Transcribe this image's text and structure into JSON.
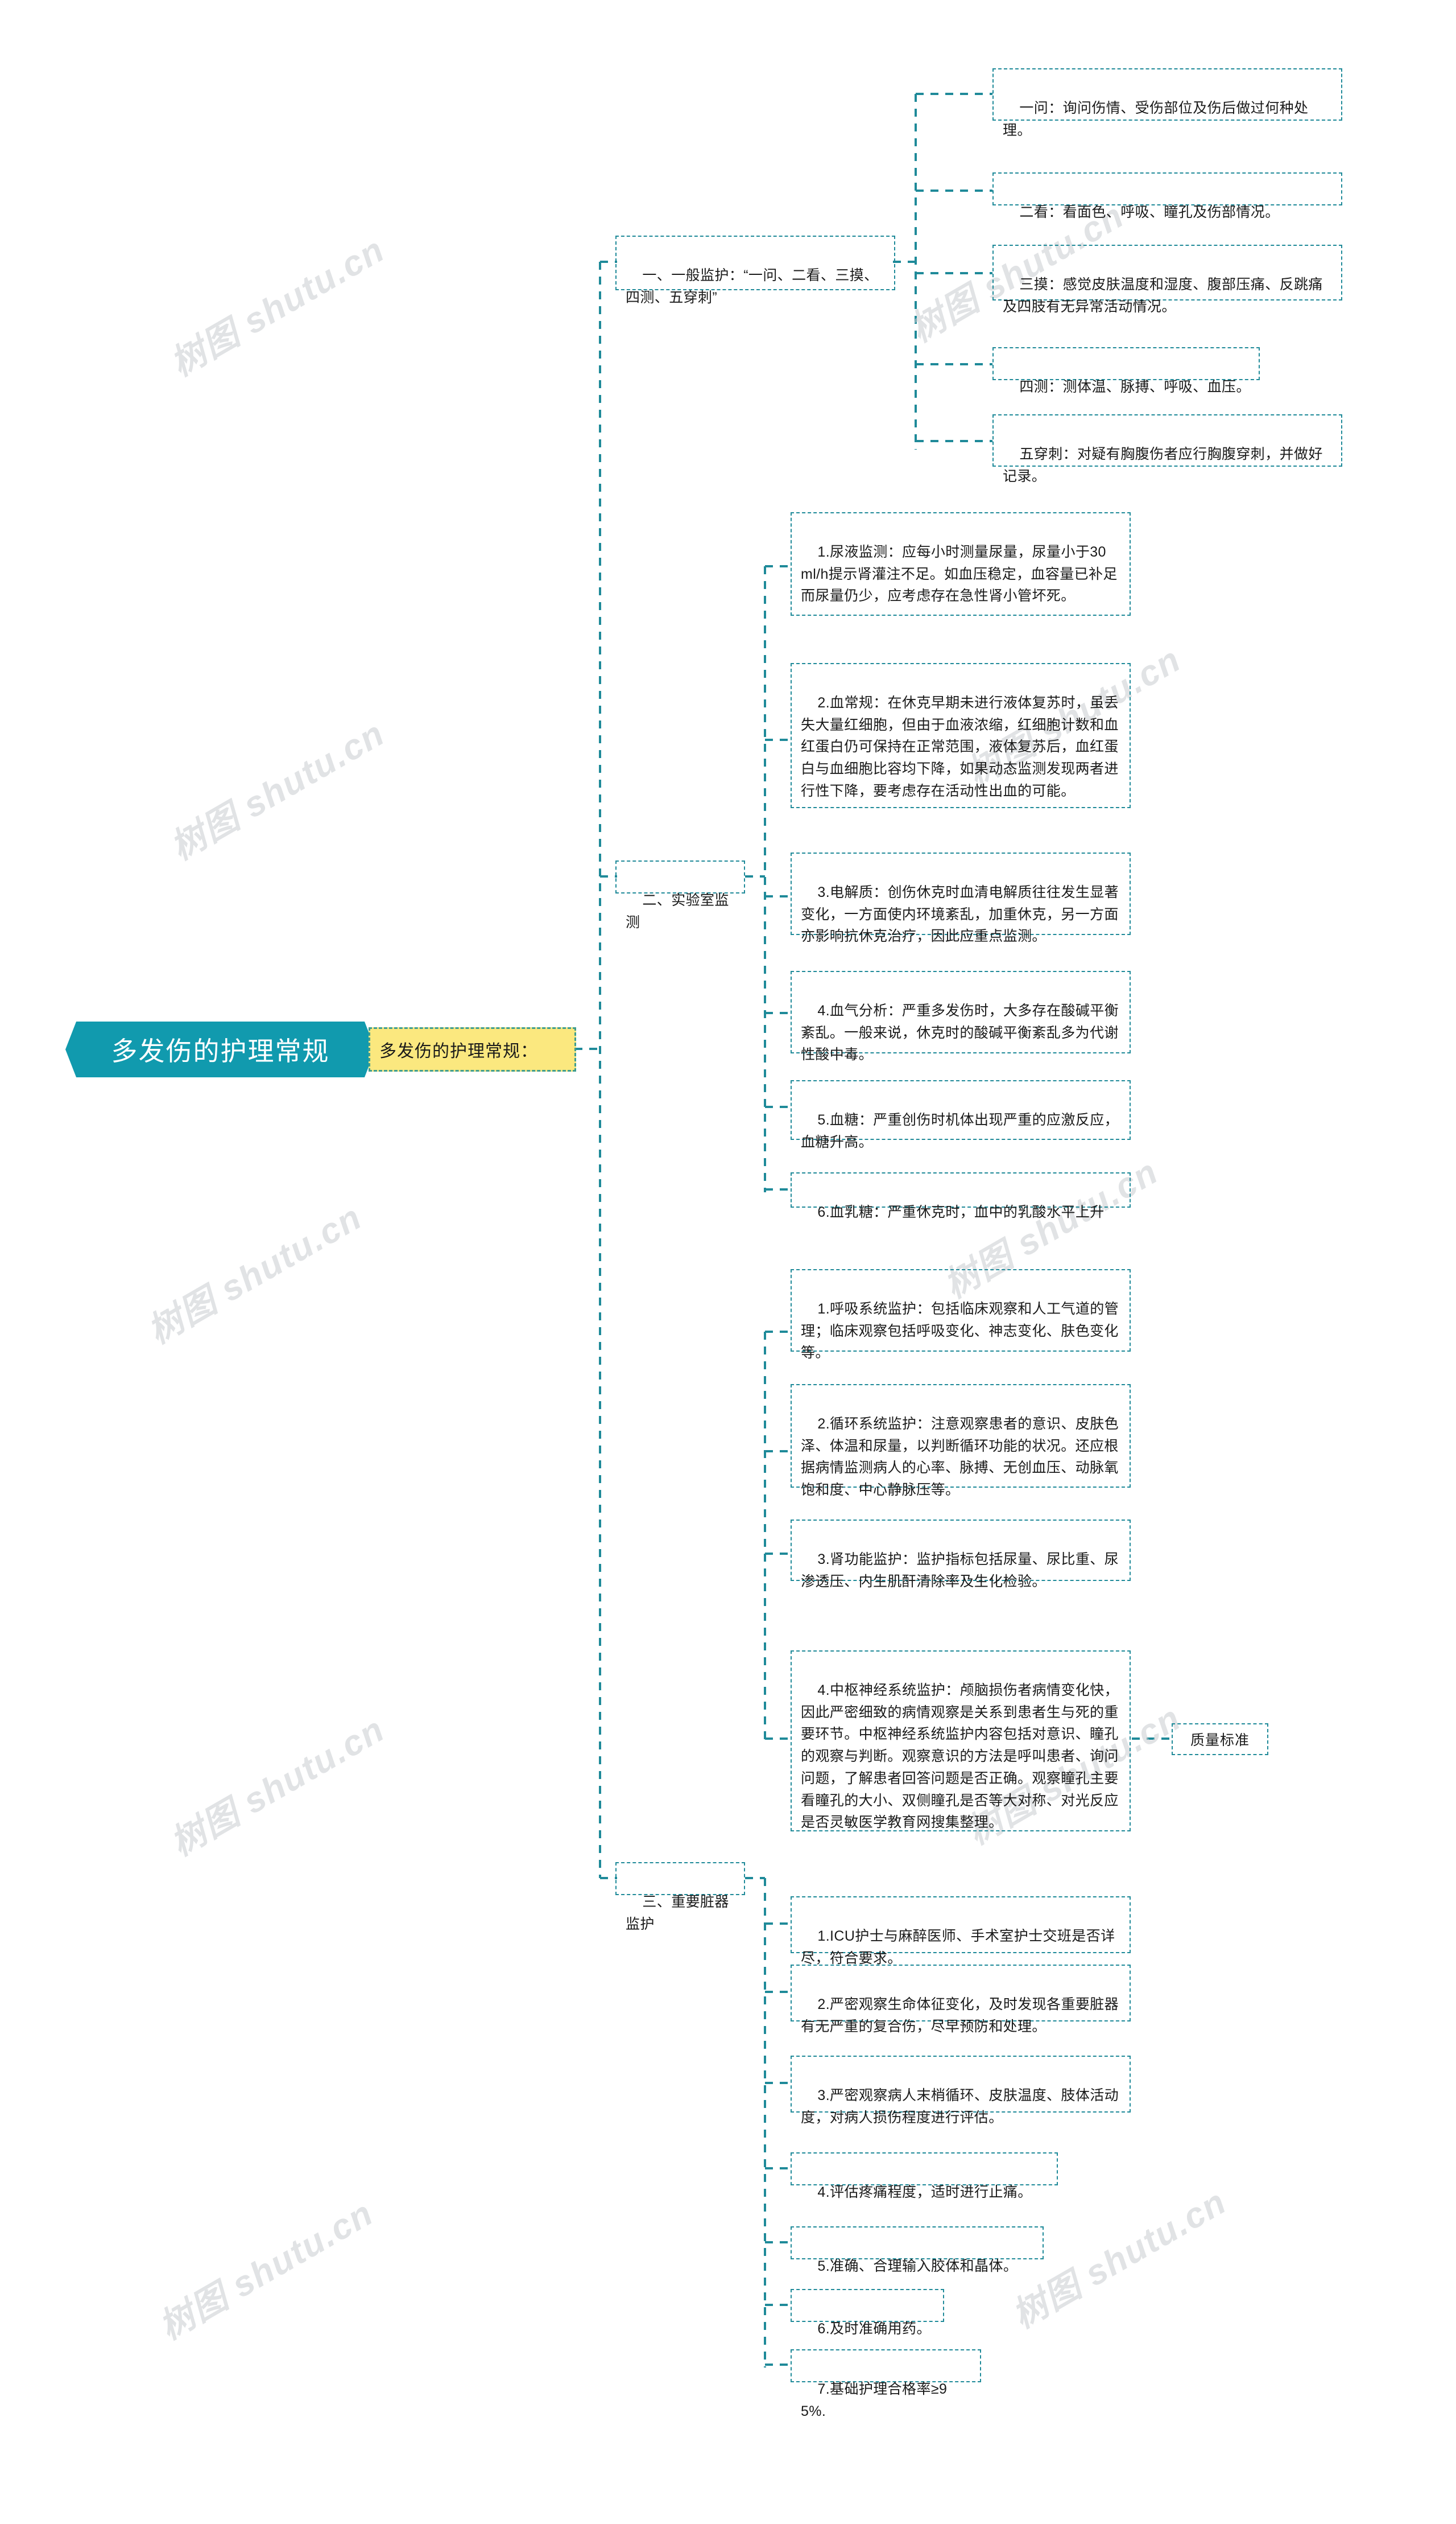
{
  "root": {
    "label": "多发伤的护理常规"
  },
  "topic": {
    "label": "多发伤的护理常规："
  },
  "quality_node": {
    "label": "质量标准"
  },
  "watermark": {
    "text": "树图 shutu.cn"
  },
  "colors": {
    "root_fill": "#119aae",
    "topic_fill": "#fbe87f",
    "topic_border": "#3f9d8f",
    "node_border": "#1f8a99",
    "link": "#1f8a99",
    "text": "#1a1a1a",
    "watermark": "#c9cdd1"
  },
  "branches": [
    {
      "id": "general-monitoring",
      "label": "一、一般监护：“一问、二看、三摸、四测、五穿刺”",
      "children": [
        {
          "label": "一问：询问伤情、受伤部位及伤后做过何种处理。"
        },
        {
          "label": "二看：看面色、呼吸、瞳孔及伤部情况。"
        },
        {
          "label": "三摸：感觉皮肤温度和湿度、腹部压痛、反跳痛及四肢有无异常活动情况。"
        },
        {
          "label": "四测：测体温、脉搏、呼吸、血压。"
        },
        {
          "label": "五穿刺：对疑有胸腹伤者应行胸腹穿刺，并做好记录。"
        }
      ]
    },
    {
      "id": "lab-monitoring",
      "label": "二、实验室监测",
      "children": [
        {
          "label": "1.尿液监测：应每小时测量尿量，尿量小于30 ml/h提示肾灌注不足。如血压稳定，血容量已补足而尿量仍少，应考虑存在急性肾小管坏死。"
        },
        {
          "label": "2.血常规：在休克早期未进行液体复苏时，虽丢失大量红细胞，但由于血液浓缩，红细胞计数和血红蛋白仍可保持在正常范围，液体复苏后，血红蛋白与血细胞比容均下降，如果动态监测发现两者进行性下降，要考虑存在活动性出血的可能。"
        },
        {
          "label": "3.电解质：创伤休克时血清电解质往往发生显著变化，一方面使内环境紊乱，加重休克，另一方面亦影响抗休克治疗，因此应重点监测。"
        },
        {
          "label": "4.血气分析：严重多发伤时，大多存在酸碱平衡紊乱。一般来说，休克时的酸碱平衡紊乱多为代谢性酸中毒。"
        },
        {
          "label": "5.血糖：严重创伤时机体出现严重的应激反应，血糖升高。"
        },
        {
          "label": "6.血乳糖：严重休克时，血中的乳酸水平上升"
        }
      ]
    },
    {
      "id": "organ-monitoring",
      "label": "三、重要脏器监护",
      "children": [
        {
          "label": "1.呼吸系统监护：包括临床观察和人工气道的管理；临床观察包括呼吸变化、神志变化、肤色变化等。"
        },
        {
          "label": "2.循环系统监护：注意观察患者的意识、皮肤色泽、体温和尿量，以判断循环功能的状况。还应根据病情监测病人的心率、脉搏、无创血压、动脉氧饱和度、中心静脉压等。"
        },
        {
          "label": "3.肾功能监护：监护指标包括尿量、尿比重、尿渗透压、内生肌酐清除率及生化检验。"
        },
        {
          "label": "4.中枢神经系统监护：颅脑损伤者病情变化快，因此严密细致的病情观察是关系到患者生与死的重要环节。中枢神经系统监护内容包括对意识、瞳孔的观察与判断。观察意识的方法是呼叫患者、询问问题，了解患者回答问题是否正确。观察瞳孔主要看瞳孔的大小、双侧瞳孔是否等大对称、对光反应是否灵敏医学教育网搜集整理。"
        }
      ]
    },
    {
      "id": "quality-standards",
      "label": "质量标准",
      "children": [
        {
          "label": "1.ICU护士与麻醉医师、手术室护士交班是否详尽，符合要求。"
        },
        {
          "label": "2.严密观察生命体征变化，及时发现各重要脏器有无严重的复合伤，尽早预防和处理。"
        },
        {
          "label": "3.严密观察病人末梢循环、皮肤温度、肢体活动度，对病人损伤程度进行评估。"
        },
        {
          "label": "4.评估疼痛程度，适时进行止痛。"
        },
        {
          "label": "5.准确、合理输入胶体和晶体。"
        },
        {
          "label": "6.及时准确用药。"
        },
        {
          "label": "7.基础护理合格率≥95%."
        }
      ]
    }
  ]
}
